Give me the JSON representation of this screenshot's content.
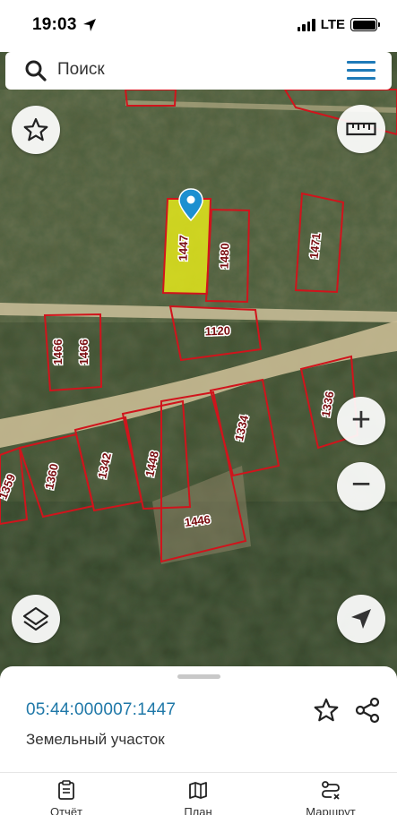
{
  "status_bar": {
    "time": "19:03",
    "network": "LTE"
  },
  "search": {
    "placeholder": "Поиск"
  },
  "map": {
    "selected_parcel": "1447",
    "parcels": [
      "1447",
      "1480",
      "1471",
      "1120",
      "1466",
      "1466",
      "1336",
      "1334",
      "1448",
      "1342",
      "1360",
      "1359",
      "1446"
    ],
    "colors": {
      "parcel_outline": "#d0141c",
      "selected_fill": "#e8ec1a",
      "marker": "#1c8fd0"
    }
  },
  "controls": {
    "favorite_icon": "star-icon",
    "ruler_icon": "ruler-icon",
    "zoom_in": "+",
    "zoom_out": "−",
    "layers_icon": "layers-icon",
    "locate_icon": "navigation-arrow-icon"
  },
  "sheet": {
    "cadastral_number": "05:44:000007:1447",
    "object_type": "Земельный участок"
  },
  "tabs": [
    {
      "label": "Отчёт",
      "icon": "clipboard-icon"
    },
    {
      "label": "План",
      "icon": "map-icon"
    },
    {
      "label": "Маршрут",
      "icon": "route-icon"
    }
  ]
}
